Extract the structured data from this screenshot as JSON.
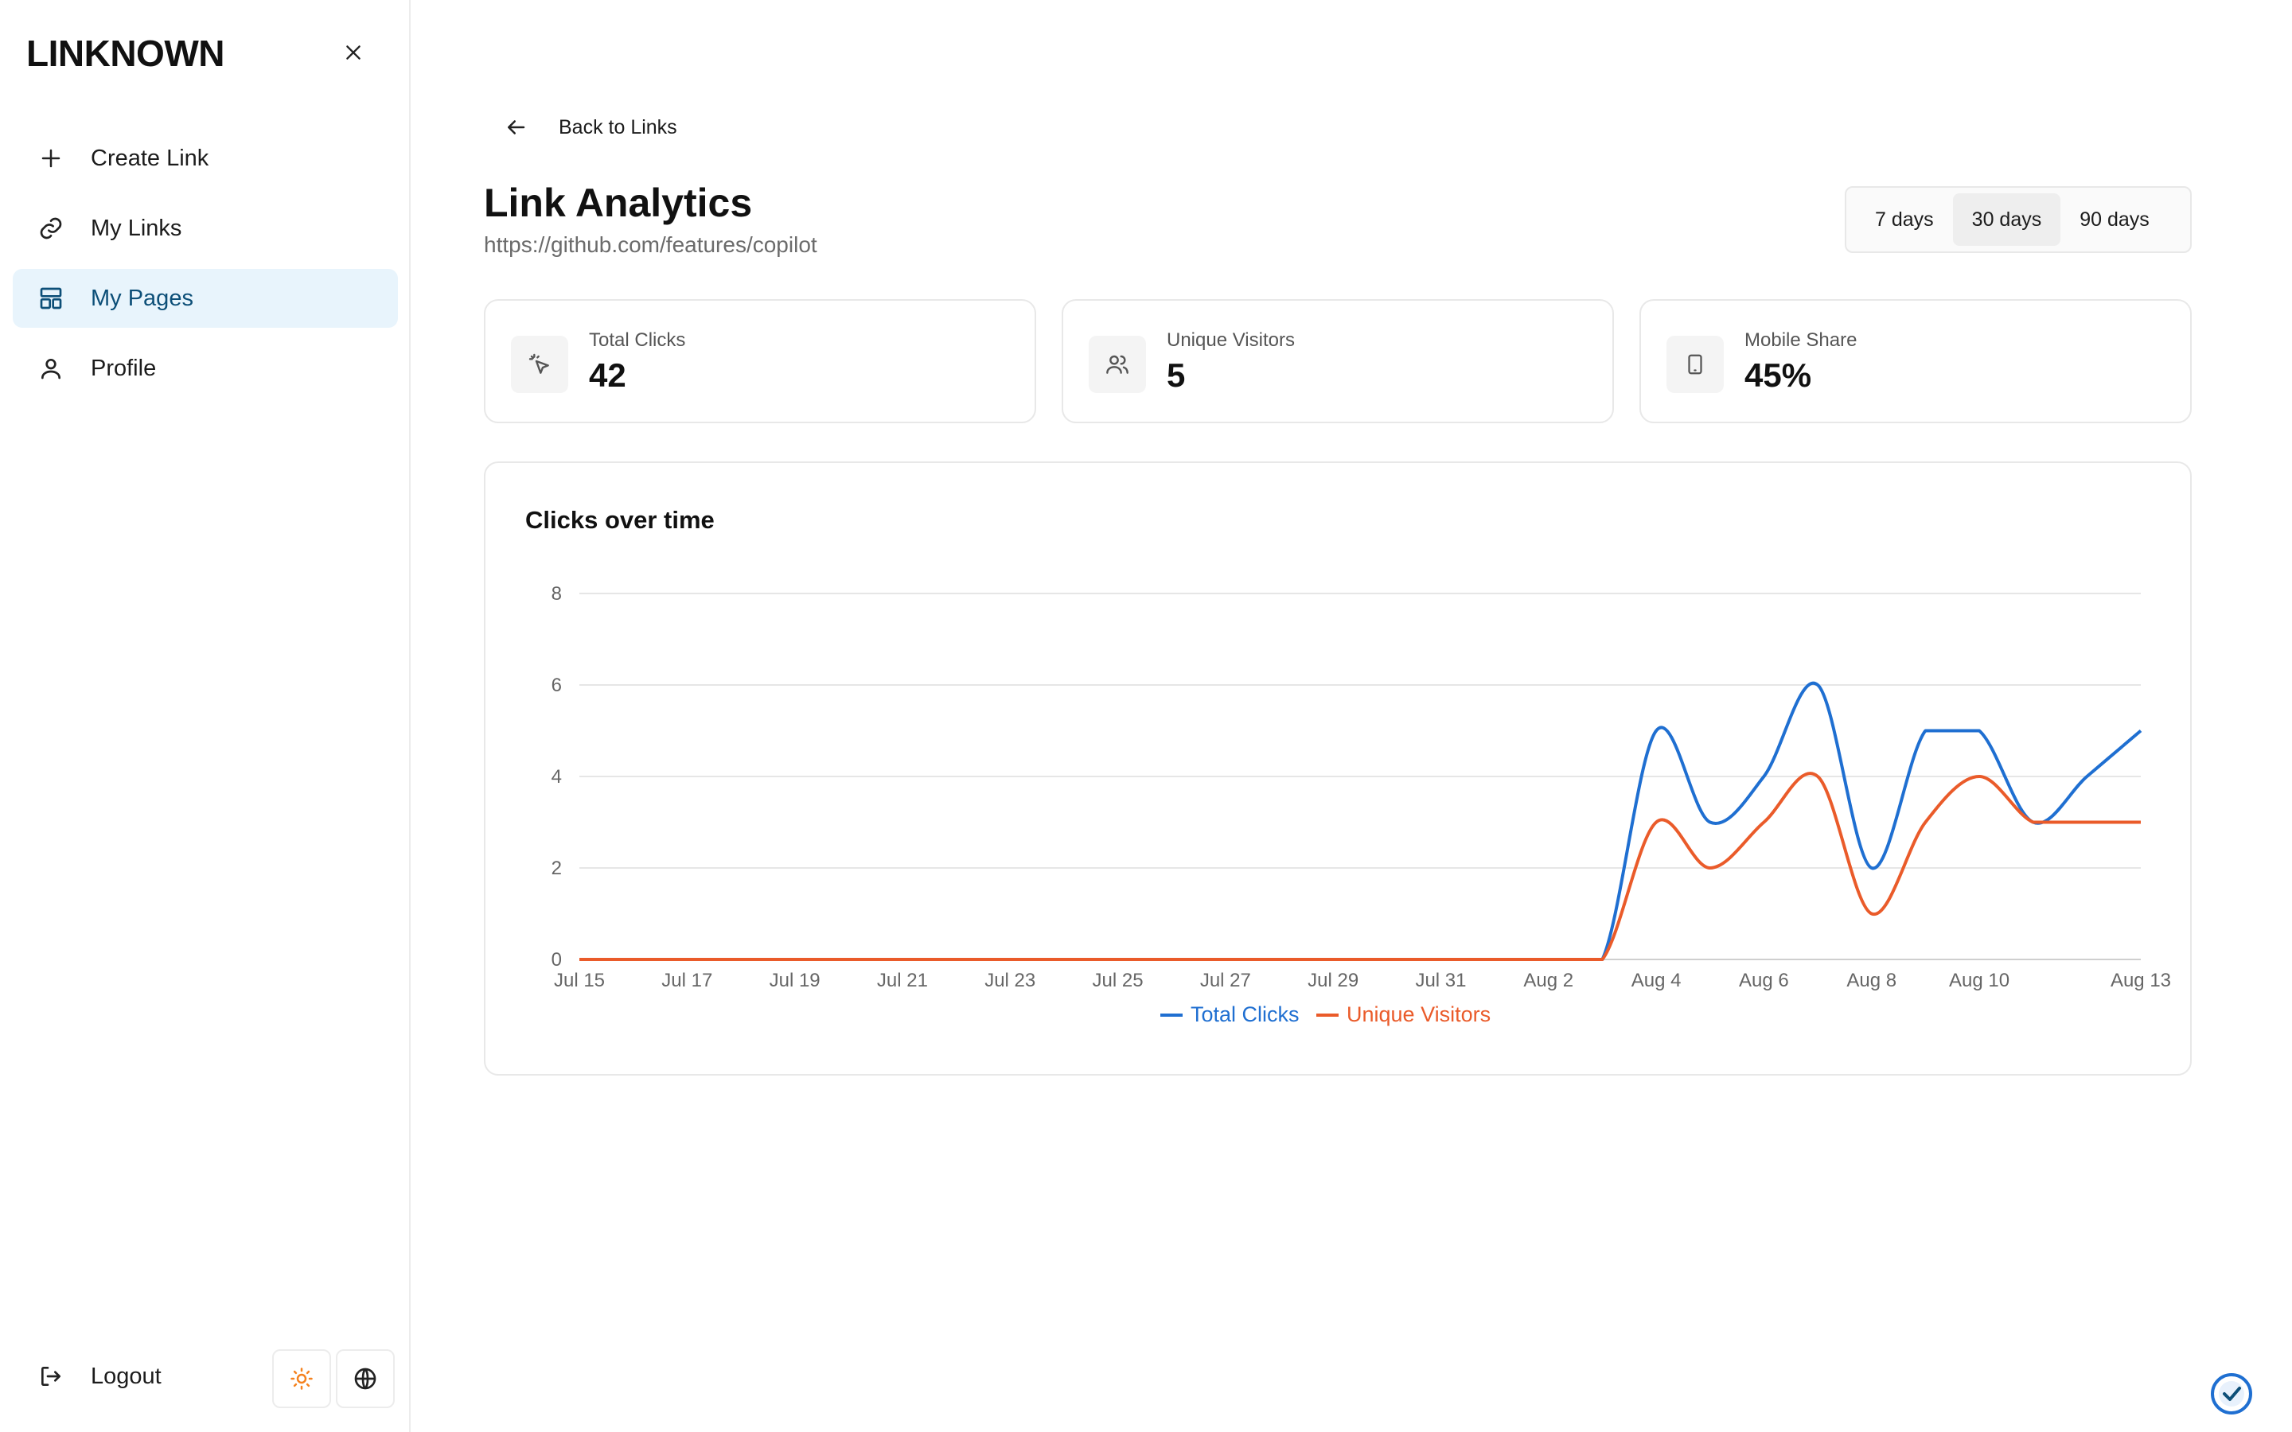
{
  "sidebar": {
    "brand": "LINKNOWN",
    "items": [
      {
        "label": "Create Link",
        "icon": "plus-icon"
      },
      {
        "label": "My Links",
        "icon": "link-icon"
      },
      {
        "label": "My Pages",
        "icon": "layout-icon",
        "active": true
      },
      {
        "label": "Profile",
        "icon": "user-icon"
      }
    ],
    "logout_label": "Logout"
  },
  "main": {
    "back_label": "Back to Links",
    "title": "Link Analytics",
    "url": "https://github.com/features/copilot",
    "ranges": [
      "7 days",
      "30 days",
      "90 days"
    ],
    "selected_range": "30 days",
    "stats": [
      {
        "label": "Total Clicks",
        "value": "42",
        "icon": "cursor-click-icon"
      },
      {
        "label": "Unique Visitors",
        "value": "5",
        "icon": "users-icon"
      },
      {
        "label": "Mobile Share",
        "value": "45%",
        "icon": "tablet-icon"
      }
    ]
  },
  "colors": {
    "accent": "#0d4f78",
    "active_bg": "#e8f4fc",
    "theme_icon": "#f5821f",
    "series_clicks": "#1f6fd1",
    "series_visitors": "#ea5b2a"
  },
  "chart_data": {
    "type": "line",
    "title": "Clicks over time",
    "xlabel": "",
    "ylabel": "",
    "ylim": [
      0,
      8
    ],
    "yticks": [
      0,
      2,
      4,
      6,
      8
    ],
    "x": [
      "Jul 15",
      "Jul 16",
      "Jul 17",
      "Jul 18",
      "Jul 19",
      "Jul 20",
      "Jul 21",
      "Jul 22",
      "Jul 23",
      "Jul 24",
      "Jul 25",
      "Jul 26",
      "Jul 27",
      "Jul 28",
      "Jul 29",
      "Jul 30",
      "Jul 31",
      "Aug 1",
      "Aug 2",
      "Aug 3",
      "Aug 4",
      "Aug 5",
      "Aug 6",
      "Aug 7",
      "Aug 8",
      "Aug 9",
      "Aug 10",
      "Aug 11",
      "Aug 12",
      "Aug 13"
    ],
    "xtick_labels": [
      "Jul 15",
      "Jul 17",
      "Jul 19",
      "Jul 21",
      "Jul 23",
      "Jul 25",
      "Jul 27",
      "Jul 29",
      "Jul 31",
      "Aug 2",
      "Aug 4",
      "Aug 6",
      "Aug 8",
      "Aug 10",
      "Aug 13"
    ],
    "series": [
      {
        "name": "Total Clicks",
        "color": "#1f6fd1",
        "values": [
          0,
          0,
          0,
          0,
          0,
          0,
          0,
          0,
          0,
          0,
          0,
          0,
          0,
          0,
          0,
          0,
          0,
          0,
          0,
          0,
          5,
          3,
          4,
          6,
          2,
          5,
          5,
          3,
          4,
          5
        ]
      },
      {
        "name": "Unique Visitors",
        "color": "#ea5b2a",
        "values": [
          0,
          0,
          0,
          0,
          0,
          0,
          0,
          0,
          0,
          0,
          0,
          0,
          0,
          0,
          0,
          0,
          0,
          0,
          0,
          0,
          3,
          2,
          3,
          4,
          1,
          3,
          4,
          3,
          3,
          3
        ]
      }
    ],
    "grid": true,
    "legend": "bottom-center"
  }
}
